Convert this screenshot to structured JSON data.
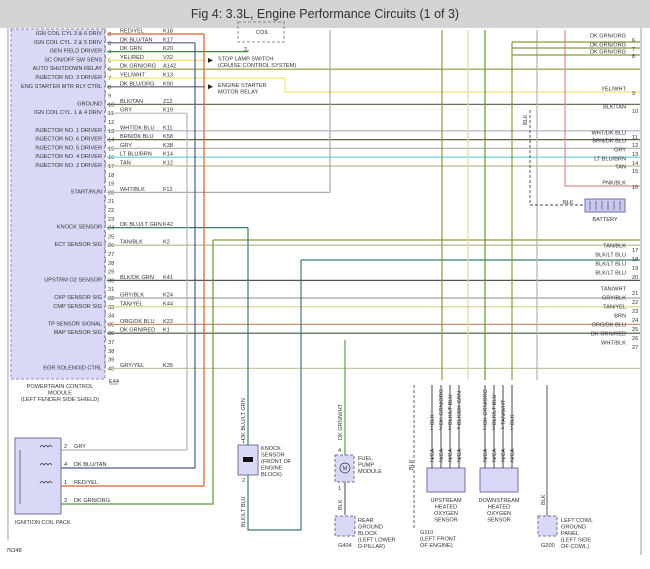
{
  "title": "Fig 4: 3.3L, Engine Performance Circuits (1 of 3)",
  "pcm": {
    "name_lines": [
      "POWERTRAIN CONTROL",
      "MODULE",
      "(LEFT FENDER SIDE SHIELD)"
    ],
    "connector": "E44",
    "pins": [
      {
        "pin": "2",
        "label": "IGN COIL CYL 3 & 6 DRIV",
        "wire": "RED/YEL",
        "code": "K18",
        "color": "#d4602c"
      },
      {
        "pin": "3",
        "label": "IGN COIL CYL. 2 & 5 DRIV",
        "wire": "DK BLU/TAN",
        "code": "K17",
        "color": "#4f5a86"
      },
      {
        "pin": "4",
        "label": "GEN FIELD DRIVER",
        "wire": "DK GRN",
        "code": "K20",
        "color": "#3c8a3c"
      },
      {
        "pin": "5",
        "label": "SC ON/OFF SW SENS",
        "wire": "YEL/RED",
        "code": "V32",
        "color": "#e9df66"
      },
      {
        "pin": "6",
        "label": "AUTO SHUTDOWN RELAY",
        "wire": "DK GRN/ORG",
        "code": "A142",
        "color": "#8a9a3c"
      },
      {
        "pin": "7",
        "label": "INJECTOR NO. 3 DRIVER",
        "wire": "YEL/WHT",
        "code": "K13",
        "color": "#eee87a"
      },
      {
        "pin": "8",
        "label": "ENG STARTER MTR RLY CTRL",
        "wire": "DK BLU/ORG",
        "code": "K90",
        "color": "#555a6a"
      },
      {
        "pin": "9",
        "label": "",
        "wire": "",
        "code": "",
        "color": ""
      },
      {
        "pin": "10",
        "label": "GROUND",
        "wire": "BLK/TAN",
        "code": "Z12",
        "color": "#6e6a5a"
      },
      {
        "pin": "11",
        "label": "IGN COIL CYL. 1 & 4 DRIV",
        "wire": "GRY",
        "code": "K19",
        "color": "#b4b4b4"
      },
      {
        "pin": "12",
        "label": "",
        "wire": "",
        "code": "",
        "color": ""
      },
      {
        "pin": "13",
        "label": "INJECTOR NO. 1 DRIVER",
        "wire": "WHT/DK BLU",
        "code": "K11",
        "color": "#a8aec8"
      },
      {
        "pin": "14",
        "label": "INJECTOR NO. 6 DRIVER",
        "wire": "BRN/DK BLU",
        "code": "K58",
        "color": "#6a5a48"
      },
      {
        "pin": "15",
        "label": "INJECTOR NO. 5 DRIVER",
        "wire": "GRY",
        "code": "K38",
        "color": "#b4b4b4"
      },
      {
        "pin": "16",
        "label": "INJECTOR NO. 4 DRIVER",
        "wire": "LT BLU/BRN",
        "code": "K14",
        "color": "#66cad8"
      },
      {
        "pin": "17",
        "label": "INJECTOR NO. 2 DRIVER",
        "wire": "TAN",
        "code": "K12",
        "color": "#c4b888"
      },
      {
        "pin": "18",
        "label": "",
        "wire": "",
        "code": "",
        "color": ""
      },
      {
        "pin": "19",
        "label": "",
        "wire": "",
        "code": "",
        "color": ""
      },
      {
        "pin": "20",
        "label": "START/RUN",
        "wire": "WHT/BLK",
        "code": "F12",
        "color": "#aaaaaa"
      },
      {
        "pin": "21",
        "label": "",
        "wire": "",
        "code": "",
        "color": ""
      },
      {
        "pin": "22",
        "label": "",
        "wire": "",
        "code": "",
        "color": ""
      },
      {
        "pin": "23",
        "label": "",
        "wire": "",
        "code": "",
        "color": ""
      },
      {
        "pin": "24",
        "label": "KNOCK SENSOR",
        "wire": "DK BLU/LT GRN",
        "code": "K42",
        "color": "#3f7a78"
      },
      {
        "pin": "25",
        "label": "",
        "wire": "",
        "code": "",
        "color": ""
      },
      {
        "pin": "26",
        "label": "ECT SENSOR SIG",
        "wire": "TAN/BLK",
        "code": "K2",
        "color": "#b8b088"
      },
      {
        "pin": "27",
        "label": "",
        "wire": "",
        "code": "",
        "color": ""
      },
      {
        "pin": "28",
        "label": "",
        "wire": "",
        "code": "",
        "color": ""
      },
      {
        "pin": "29",
        "label": "",
        "wire": "",
        "code": "",
        "color": ""
      },
      {
        "pin": "30",
        "label": "UPSTRM O2 SENSOR",
        "wire": "BLK/DK GRN",
        "code": "K41",
        "color": "#4a5a4a"
      },
      {
        "pin": "31",
        "label": "",
        "wire": "",
        "code": "",
        "color": ""
      },
      {
        "pin": "32",
        "label": "CKP SENSOR SIG",
        "wire": "GRY/BLK",
        "code": "K24",
        "color": "#a0a4a8"
      },
      {
        "pin": "33",
        "label": "CMP SENSOR SIG",
        "wire": "TAN/YEL",
        "code": "K44",
        "color": "#d8d080"
      },
      {
        "pin": "34",
        "label": "",
        "wire": "",
        "code": "",
        "color": ""
      },
      {
        "pin": "35",
        "label": "TP SENSOR SIGNAL",
        "wire": "ORG/DK BLU",
        "code": "K22",
        "color": "#c89070"
      },
      {
        "pin": "36",
        "label": "MAP SENSOR SIG",
        "wire": "DK GRN/RED",
        "code": "K1",
        "color": "#3a5a3a"
      },
      {
        "pin": "37",
        "label": "",
        "wire": "",
        "code": "",
        "color": ""
      },
      {
        "pin": "38",
        "label": "",
        "wire": "",
        "code": "",
        "color": ""
      },
      {
        "pin": "39",
        "label": "",
        "wire": "",
        "code": "",
        "color": ""
      },
      {
        "pin": "40",
        "label": "EGR SOLENOID CTRL",
        "wire": "GRY/YEL",
        "code": "K35",
        "color": "#c8c8a0"
      }
    ]
  },
  "right_connector": [
    {
      "pin": "6",
      "wire": "DK GRN/ORG"
    },
    {
      "pin": "7",
      "wire": "DK GRN/ORG"
    },
    {
      "pin": "8",
      "wire": "DK GRN/ORG"
    },
    {
      "pin": "9",
      "wire": "YEL/WHT"
    },
    {
      "pin": "10",
      "wire": "BLK/TAN"
    },
    {
      "pin": "11",
      "wire": "WHT/DK BLU"
    },
    {
      "pin": "12",
      "wire": "BRN/DK BLU"
    },
    {
      "pin": "13",
      "wire": "GRY"
    },
    {
      "pin": "14",
      "wire": "LT BLU/BRN"
    },
    {
      "pin": "15",
      "wire": "TAN"
    },
    {
      "pin": "16",
      "wire": "PNK/BLK"
    },
    {
      "pin": "17",
      "wire": "TAN/BLK"
    },
    {
      "pin": "18",
      "wire": "BLK/LT BLU"
    },
    {
      "pin": "19",
      "wire": "BLK/LT BLU"
    },
    {
      "pin": "20",
      "wire": "BLK/LT BLU"
    },
    {
      "pin": "21",
      "wire": "TAN/WHT"
    },
    {
      "pin": "22",
      "wire": "GRY/BLK"
    },
    {
      "pin": "23",
      "wire": "TAN/YEL"
    },
    {
      "pin": "24",
      "wire": "BRN"
    },
    {
      "pin": "25",
      "wire": "ORG/DK BLU"
    },
    {
      "pin": "26",
      "wire": "DK GRN/RED"
    },
    {
      "pin": "27",
      "wire": "WHT/BLK"
    }
  ],
  "arrows": {
    "stop_lamp": [
      "STOP LAMP SWITCH",
      "(CRUISE CONTROL SYSTEM)"
    ],
    "starter": [
      "ENGINE STARTER",
      "MOTOR RELAY"
    ]
  },
  "coil_top": {
    "label": "COIL",
    "pin": "2"
  },
  "battery": {
    "label": "BATTERY",
    "wire": "BLK",
    "ground_wire": "BLK"
  },
  "ignition_coil_pack": {
    "label": "IGNITION COIL PACK",
    "pins": [
      {
        "pin": "2",
        "wire": "GRY"
      },
      {
        "pin": "4",
        "wire": "DK BLU/TAN"
      },
      {
        "pin": "1",
        "wire": "RED/YEL"
      },
      {
        "pin": "3",
        "wire": "DK GRN/ORG"
      }
    ]
  },
  "knock_sensor": {
    "lines": [
      "KNOCK",
      "SENSOR",
      "(FRONT OF",
      "ENGINE",
      "BLOCK)"
    ],
    "wire_top": "DK BLU/LT GRN",
    "wire_bottom": "BLK/LT BLU",
    "pin_top": "1",
    "pin_bottom": "2"
  },
  "fuel_pump": {
    "lines": [
      "FUEL",
      "PUMP",
      "MODULE"
    ],
    "wire_top": "DK GRN/WHT",
    "wire_bottom": "BLK",
    "pin_top": "4",
    "pin_bottom": "1",
    "symbol": "M"
  },
  "rear_ground": {
    "lines": [
      "REAR",
      "GROUND",
      "BLOCK",
      "(LEFT LOWER",
      "D-PILLAR)"
    ],
    "id": "G404"
  },
  "g110": {
    "lines": [
      "G110",
      "(LEFT FRONT",
      "OF ENGINE)"
    ],
    "wire": "BLK"
  },
  "upstream_o2": {
    "lines": [
      "UPSTREAM",
      "HEATED",
      "OXYGEN",
      "SENSOR"
    ],
    "wires": [
      {
        "pin": "1",
        "wire": "BLK"
      },
      {
        "pin": "2",
        "wire": "DK GRN/ORG"
      },
      {
        "pin": "3",
        "wire": "BLK/LT BLU"
      },
      {
        "pin": "4",
        "wire": "BLK/DK GRN"
      }
    ],
    "conn": "N/CA"
  },
  "downstream_o2": {
    "lines": [
      "DOWNSTREAM",
      "HEATED",
      "OXYGEN",
      "SENSOR"
    ],
    "wires": [
      {
        "pin": "2",
        "wire": "DK GRN/ORG"
      },
      {
        "pin": "3",
        "wire": "BLK/LT BLU"
      },
      {
        "pin": "4",
        "wire": "TAN/WHT"
      },
      {
        "pin": "1",
        "wire": "BLK"
      }
    ],
    "conn": "N/CA"
  },
  "cowl_ground": {
    "lines": [
      "LEFT COWL",
      "GROUND",
      "PANEL",
      "(LEFT SIDE",
      "OF COWL)"
    ],
    "id": "G200",
    "wire": "BLK"
  },
  "figure_number": "76348"
}
